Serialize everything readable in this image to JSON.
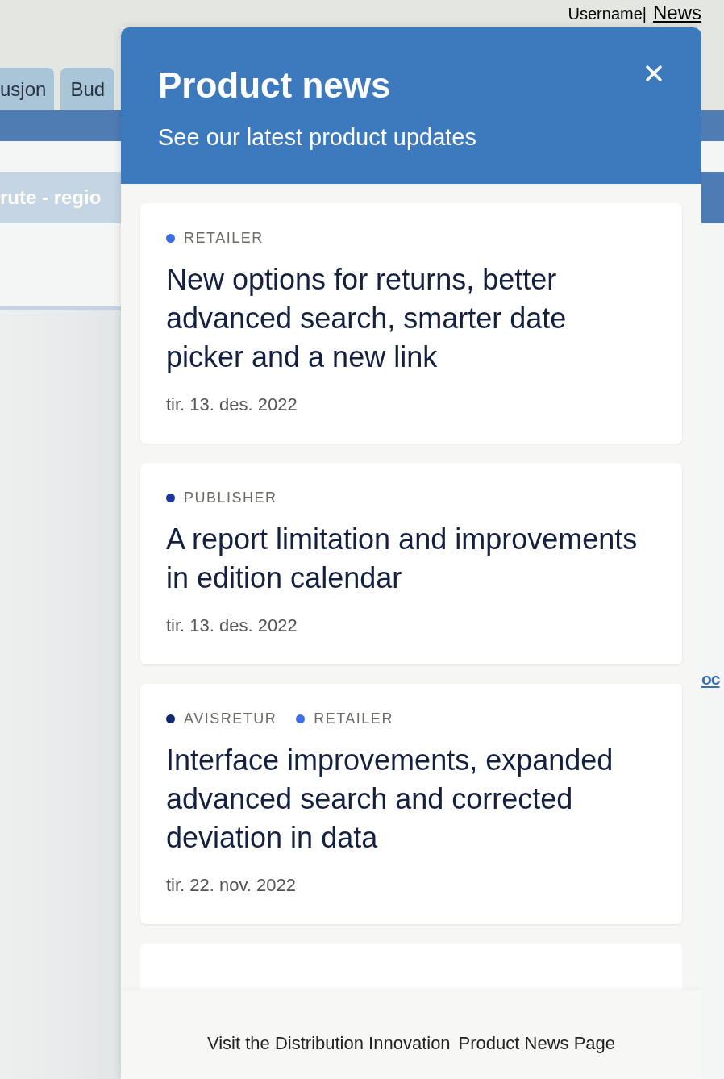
{
  "header": {
    "username": "Username|",
    "news_link": "News"
  },
  "background_tabs": [
    {
      "label": "usjon"
    },
    {
      "label": "Bud"
    }
  ],
  "background_band": "rute - regio",
  "background_link": "oc",
  "panel": {
    "title": "Product news",
    "subtitle": "See our latest product updates",
    "items": [
      {
        "tags": [
          {
            "label": "RETAILER",
            "color": "#3b6ee8"
          }
        ],
        "title": "New options for returns, better advanced search, smarter date picker and a new link",
        "date": "tir. 13. des. 2022"
      },
      {
        "tags": [
          {
            "label": "PUBLISHER",
            "color": "#1c3a9e"
          }
        ],
        "title": "A report limitation and improvements in edition calendar",
        "date": "tir. 13. des. 2022"
      },
      {
        "tags": [
          {
            "label": "AVISRETUR",
            "color": "#13296f"
          },
          {
            "label": "RETAILER",
            "color": "#3b6ee8"
          }
        ],
        "title": "Interface improvements, expanded advanced search and corrected deviation in data",
        "date": "tir. 22. nov. 2022"
      }
    ],
    "footer": {
      "text": "Visit the Distribution Innovation",
      "link": "Product News Page"
    }
  }
}
